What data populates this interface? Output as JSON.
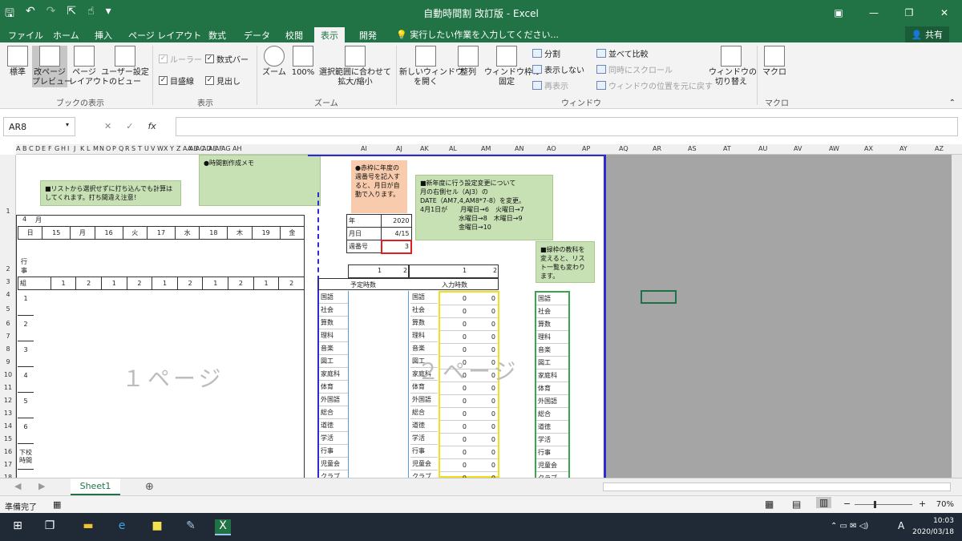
{
  "app": {
    "title": "自動時間割 改訂版 - Excel",
    "tabs": [
      "ファイル",
      "ホーム",
      "挿入",
      "ページ レイアウト",
      "数式",
      "データ",
      "校閲",
      "表示",
      "開発"
    ],
    "active_tab": "表示",
    "tell_me": "実行したい作業を入力してください...",
    "share": "共有"
  },
  "ribbon": {
    "standard": "標準",
    "page_break": "改ページ\nプレビュー",
    "page_layout": "ページ\nレイアウト",
    "custom_view": "ユーザー設定\nのビュー",
    "ruler": "ルーラー",
    "formula_bar": "数式バー",
    "gridlines": "目盛線",
    "headings": "見出し",
    "zoom": "ズーム",
    "zoom100": "100%",
    "zoom_sel": "選択範囲に合わせて\n拡大/縮小",
    "new_window": "新しいウィンドウ\nを開く",
    "arrange": "整列",
    "freeze": "ウィンドウ枠の\n固定",
    "split": "分割",
    "hide": "表示しない",
    "unhide": "再表示",
    "side_by_side": "並べて比較",
    "sync_scroll": "同時にスクロール",
    "reset_pos": "ウィンドウの位置を元に戻す",
    "switch_win": "ウィンドウの\n切り替え",
    "macro": "マクロ",
    "group_book": "ブックの表示",
    "group_show": "表示",
    "group_zoom": "ズーム",
    "group_window": "ウィンドウ",
    "group_macro": "マクロ"
  },
  "formula": {
    "namebox": "AR8",
    "cancel": "✕",
    "enter": "✓",
    "fx": "fx"
  },
  "columns": [
    "A",
    "B",
    "C",
    "D",
    "E",
    "F",
    "G",
    "H",
    "I",
    "J",
    "K",
    "L",
    "M",
    "N",
    "O",
    "P",
    "Q",
    "R",
    "S",
    "T",
    "U",
    "V",
    "W",
    "X",
    "Y",
    "Z",
    "AA",
    "AB",
    "AC",
    "AD",
    "AE",
    "AF",
    "AG",
    "AH",
    "AI",
    "AJ",
    "AK",
    "AL",
    "AM",
    "AN",
    "AO",
    "AP",
    "AQ",
    "AR",
    "AS",
    "AT",
    "AU",
    "AV",
    "AW",
    "AX",
    "AY",
    "AZ"
  ],
  "rows": [
    "1",
    "2",
    "3",
    "4",
    "5",
    "6",
    "7",
    "8",
    "9",
    "10",
    "11",
    "12",
    "13",
    "14",
    "15",
    "16",
    "17",
    "18",
    "19",
    "20",
    "21",
    "22"
  ],
  "sheet": {
    "note1": "■リストから選択せずに打ち込んでも計算はしてくれます。打ち間違え注意！",
    "note2": "●時間割作成メモ",
    "note3": "●赤枠に年度の週番号を記入すると、月日が自動で入ります。",
    "note4": "■新年度に行う設定変更について\n月の右側セル（AJ3）の\nDATE（AM7,4,AM8*7-8）を変更。\n4月1日が　　月曜日→6　火曜日→7\n　　　　　　水曜日→8　木曜日→9\n　　　　　　金曜日→10",
    "note5": "■緑枠の教科を変えると、リスト一覧も変わります。",
    "month": "4",
    "month_label": "月",
    "day_header": [
      "日",
      "15",
      "月",
      "16",
      "火",
      "17",
      "水",
      "18",
      "木",
      "19",
      "金"
    ],
    "row_gyouji": "行事",
    "row_kumi": "組",
    "kumi_nums": [
      "1",
      "2",
      "1",
      "2",
      "1",
      "2",
      "1",
      "2",
      "1",
      "2"
    ],
    "periods": [
      "1",
      "2",
      "3",
      "4",
      "5",
      "6",
      "下校時間"
    ],
    "watermark1": "１ページ",
    "watermark2": "２ページ",
    "year_label": "年",
    "year": "2020",
    "date_label": "月日",
    "date": "4/15",
    "week_label": "週番号",
    "week": "3",
    "plan_label": "予定時数",
    "input_label": "入力時数",
    "one": "1",
    "two": "2",
    "subjects": [
      "国語",
      "社会",
      "算数",
      "理科",
      "音楽",
      "図工",
      "家庭科",
      "体育",
      "外国語",
      "総合",
      "道徳",
      "学活",
      "行事",
      "児童会",
      "クラブ"
    ],
    "zero": "0"
  },
  "sheet_tab": "Sheet1",
  "status": {
    "ready": "準備完了",
    "zoom": "70%"
  },
  "taskbar": {
    "time": "10:03",
    "date": "2020/03/18",
    "ime": "A"
  }
}
